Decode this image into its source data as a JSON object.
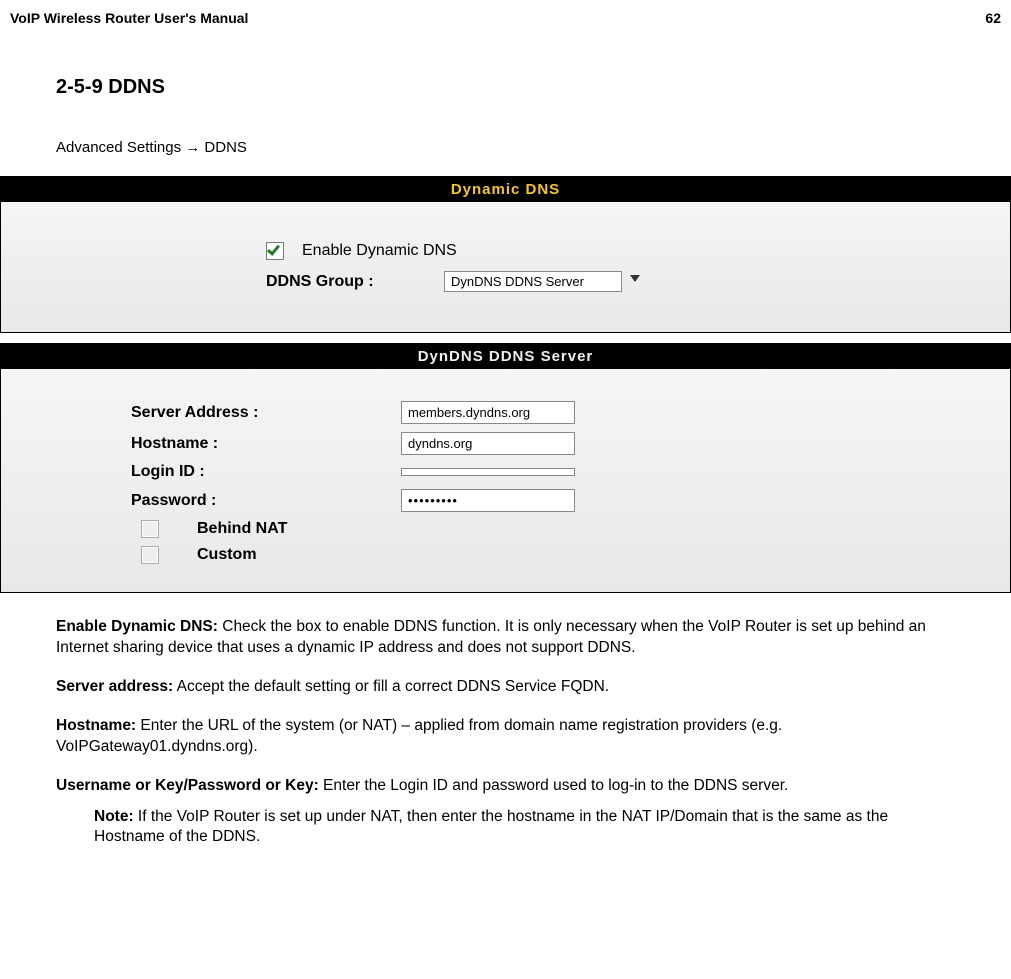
{
  "header": {
    "title": "VoIP Wireless Router User's Manual",
    "page_number": "62"
  },
  "section": {
    "title": "2-5-9 DDNS",
    "breadcrumb": "Advanced Settings  →  DDNS"
  },
  "panel1": {
    "title": "Dynamic DNS",
    "enable_label": "Enable Dynamic DNS",
    "group_label": "DDNS Group :",
    "group_value": "DynDNS DDNS Server"
  },
  "panel2": {
    "title": "DynDNS DDNS Server",
    "server_label": "Server Address :",
    "server_value": "members.dyndns.org",
    "hostname_label": "Hostname :",
    "hostname_value": "dyndns.org",
    "login_label": "Login ID :",
    "login_value": "",
    "password_label": "Password :",
    "password_value": "•••••••••",
    "behind_nat_label": "Behind NAT",
    "custom_label": "Custom"
  },
  "body": {
    "p1_bold": "Enable Dynamic DNS:",
    "p1_text": " Check the box to enable DDNS function. It is only necessary when the VoIP Router is set up behind an Internet sharing device that uses a dynamic IP address and does not support DDNS.",
    "p2_bold": "Server address:",
    "p2_text": " Accept the default setting or fill a correct DDNS Service FQDN.",
    "p3_bold": "Hostname:",
    "p3_text": " Enter the URL of the system (or NAT) – applied from domain name registration providers (e.g. VoIPGateway01.dyndns.org).",
    "p4_bold": "Username or Key/Password or Key:",
    "p4_text": " Enter the Login ID and password used to log-in to the DDNS server.",
    "note_bold": "Note:",
    "note_text": " If the VoIP Router is set up under NAT, then enter the hostname in the NAT IP/Domain that is the same as the Hostname of the DDNS."
  }
}
